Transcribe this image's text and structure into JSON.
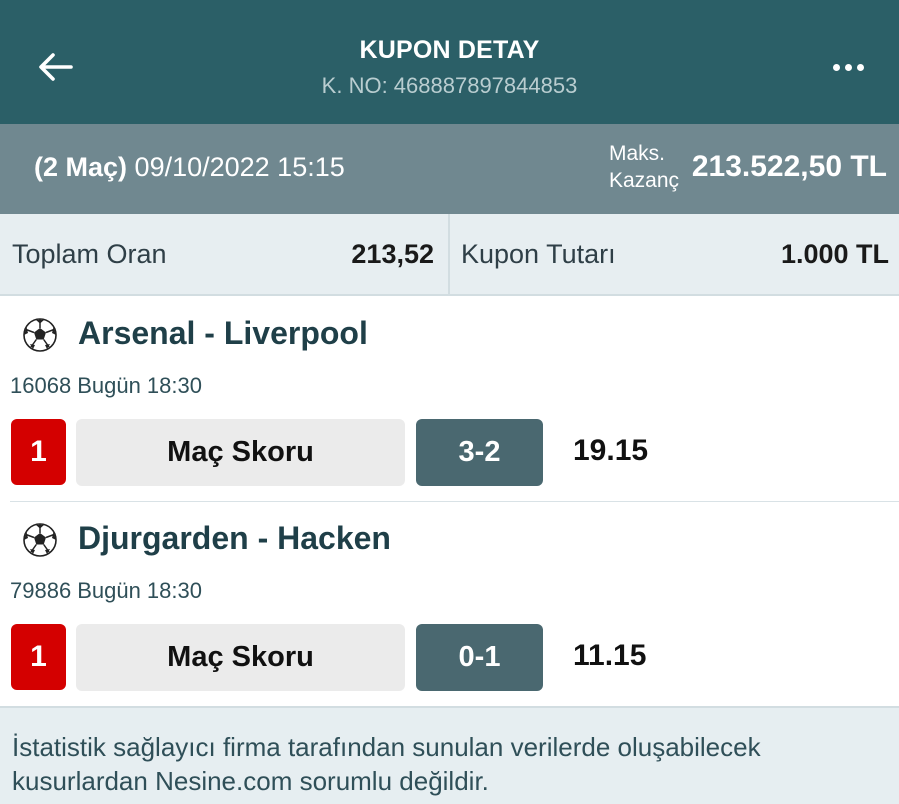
{
  "header": {
    "title": "KUPON DETAY",
    "subtitle": "K. NO: 468887897844853",
    "back_icon": "arrow-left-icon",
    "more_icon": "more-horizontal-icon"
  },
  "summary": {
    "match_count": "(2 Maç)",
    "datetime": "09/10/2022 15:15",
    "max_win_label_line1": "Maks.",
    "max_win_label_line2": "Kazanç",
    "max_win_value": "213.522,50 TL"
  },
  "totals": {
    "total_odds_label": "Toplam Oran",
    "total_odds_value": "213,52",
    "stake_label": "Kupon Tutarı",
    "stake_value": "1.000 TL"
  },
  "matches": [
    {
      "teams": "Arsenal - Liverpool",
      "code": "16068",
      "time": "Bugün 18:30",
      "pick": "1",
      "market": "Maç Skoru",
      "selection": "3-2",
      "odd": "19.15"
    },
    {
      "teams": "Djurgarden - Hacken",
      "code": "79886",
      "time": "Bugün 18:30",
      "pick": "1",
      "market": "Maç Skoru",
      "selection": "0-1",
      "odd": "11.15"
    }
  ],
  "footer": {
    "disclaimer": "İstatistik sağlayıcı firma tarafından sunulan verilerde oluşabilecek kusurlardan Nesine.com sorumlu değildir."
  },
  "colors": {
    "header_bg": "#2b5f67",
    "summary_bg": "#708890",
    "pick_red": "#d40000",
    "selection_bg": "#4a6870"
  }
}
